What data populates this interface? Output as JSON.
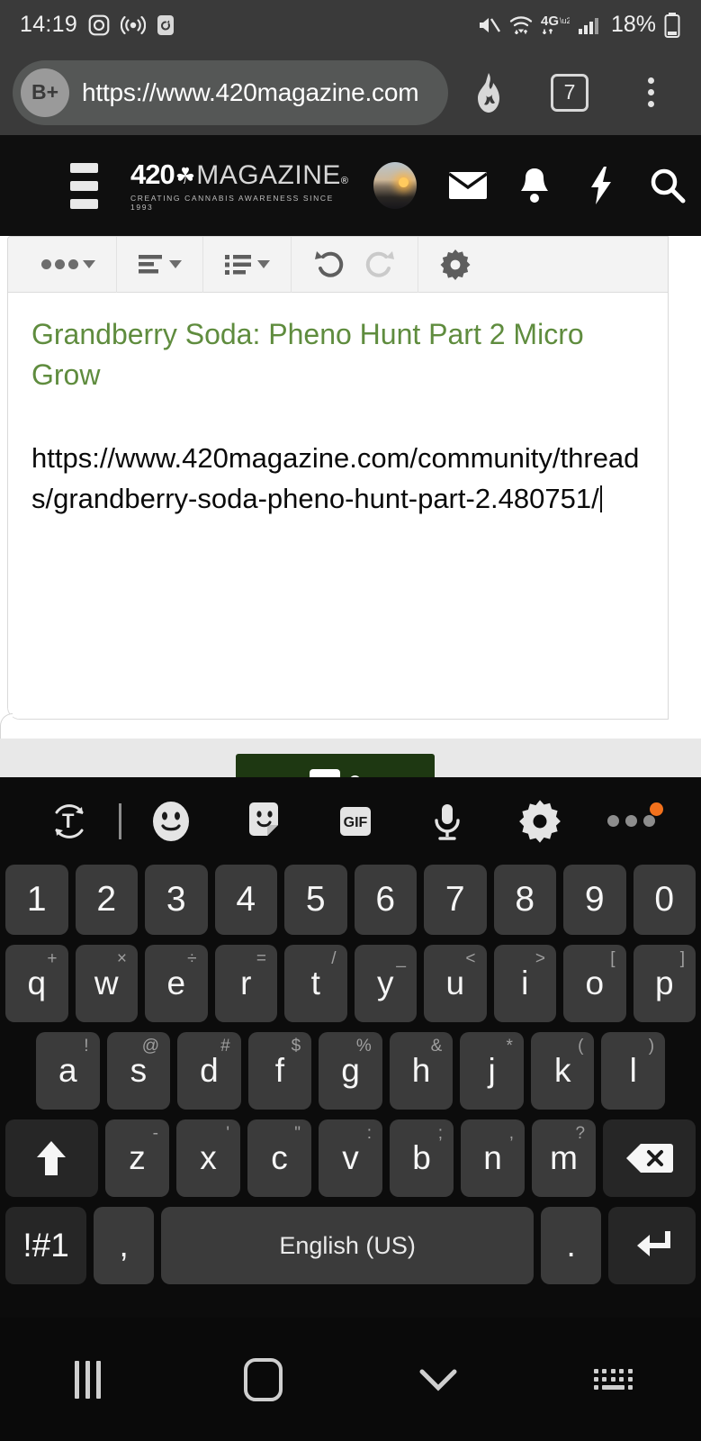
{
  "status_bar": {
    "time": "14:19",
    "battery_percent": "18%",
    "network_type": "4G",
    "left_icons": [
      "instagram-icon",
      "broadcast-icon",
      "alarm-icon"
    ],
    "right_icons": [
      "mute-icon",
      "wifi-icon",
      "4g-icon",
      "signal-bars-icon",
      "battery-icon"
    ]
  },
  "browser": {
    "profile_badge": "B+",
    "url": "https://www.420magazine.com",
    "tab_count": "7",
    "icons": [
      "brave-shield-flame-icon",
      "tabs-icon",
      "overflow-menu-icon"
    ]
  },
  "site_header": {
    "logo_number": "420",
    "logo_leaf": "☘",
    "logo_word": "MAGAZINE",
    "logo_registered": "®",
    "logo_tagline": "CREATING CANNABIS AWARENESS SINCE 1993",
    "icons": [
      "hamburger-menu-icon",
      "user-avatar",
      "mail-icon",
      "bell-icon",
      "lightning-icon",
      "search-icon"
    ]
  },
  "editor": {
    "toolbar_items": [
      {
        "name": "more-options-dropdown",
        "glyph": "•••"
      },
      {
        "name": "text-align-dropdown",
        "glyph": "align"
      },
      {
        "name": "list-dropdown",
        "glyph": "list"
      },
      {
        "name": "undo-button",
        "glyph": "↺"
      },
      {
        "name": "redo-button",
        "glyph": "↻",
        "state": "disabled"
      },
      {
        "name": "settings-gear-button",
        "glyph": "gear"
      }
    ],
    "title_text": "Grandberry Soda: Pheno Hunt Part 2 Micro Grow",
    "url_text": "https://www.420magazine.com/community/threads/grandberry-soda-pheno-hunt-part-2.480751/",
    "title_color": "#5f8c3e",
    "submit_button_label": ""
  },
  "keyboard": {
    "toolbar": [
      {
        "name": "text-translate-icon",
        "glyph": "T"
      },
      {
        "name": "emoji-icon",
        "glyph": "☺"
      },
      {
        "name": "sticker-icon",
        "glyph": "sticker"
      },
      {
        "name": "gif-icon",
        "glyph": "GIF"
      },
      {
        "name": "microphone-icon",
        "glyph": "mic"
      },
      {
        "name": "keyboard-settings-gear-icon",
        "glyph": "gear"
      },
      {
        "name": "keyboard-overflow-icon",
        "glyph": "•••",
        "badge": true
      }
    ],
    "badge_color": "#f2711c",
    "rows": [
      {
        "name": "number-row",
        "keys": [
          {
            "main": "1"
          },
          {
            "main": "2"
          },
          {
            "main": "3"
          },
          {
            "main": "4"
          },
          {
            "main": "5"
          },
          {
            "main": "6"
          },
          {
            "main": "7"
          },
          {
            "main": "8"
          },
          {
            "main": "9"
          },
          {
            "main": "0"
          }
        ]
      },
      {
        "name": "qwerty-row",
        "keys": [
          {
            "main": "q",
            "sub": "+"
          },
          {
            "main": "w",
            "sub": "×"
          },
          {
            "main": "e",
            "sub": "÷"
          },
          {
            "main": "r",
            "sub": "="
          },
          {
            "main": "t",
            "sub": "/"
          },
          {
            "main": "y",
            "sub": "_"
          },
          {
            "main": "u",
            "sub": "<"
          },
          {
            "main": "i",
            "sub": ">"
          },
          {
            "main": "o",
            "sub": "["
          },
          {
            "main": "p",
            "sub": "]"
          }
        ]
      },
      {
        "name": "asdf-row",
        "keys": [
          {
            "main": "a",
            "sub": "!"
          },
          {
            "main": "s",
            "sub": "@"
          },
          {
            "main": "d",
            "sub": "#"
          },
          {
            "main": "f",
            "sub": "$"
          },
          {
            "main": "g",
            "sub": "%"
          },
          {
            "main": "h",
            "sub": "&"
          },
          {
            "main": "j",
            "sub": "*"
          },
          {
            "main": "k",
            "sub": "("
          },
          {
            "main": "l",
            "sub": ")"
          }
        ]
      },
      {
        "name": "zxcv-row",
        "keys": [
          {
            "main": "z",
            "sub": "-"
          },
          {
            "main": "x",
            "sub": "'"
          },
          {
            "main": "c",
            "sub": "\""
          },
          {
            "main": "v",
            "sub": ":"
          },
          {
            "main": "b",
            "sub": ";"
          },
          {
            "main": "n",
            "sub": ","
          },
          {
            "main": "m",
            "sub": "?"
          }
        ]
      },
      {
        "name": "bottom-row",
        "keys": [
          {
            "main": "!#1"
          },
          {
            "main": ","
          },
          {
            "main": "English (US)"
          },
          {
            "main": "."
          }
        ]
      }
    ],
    "shift_key": "shift-key",
    "backspace_key": "backspace-key",
    "enter_key": "enter-key",
    "space_label": "English (US)",
    "symbols_label": "!#1",
    "comma_label": ",",
    "period_label": "."
  },
  "nav_bar": {
    "items": [
      "recents-button",
      "home-button",
      "back-button",
      "keyboard-hide-button"
    ]
  }
}
